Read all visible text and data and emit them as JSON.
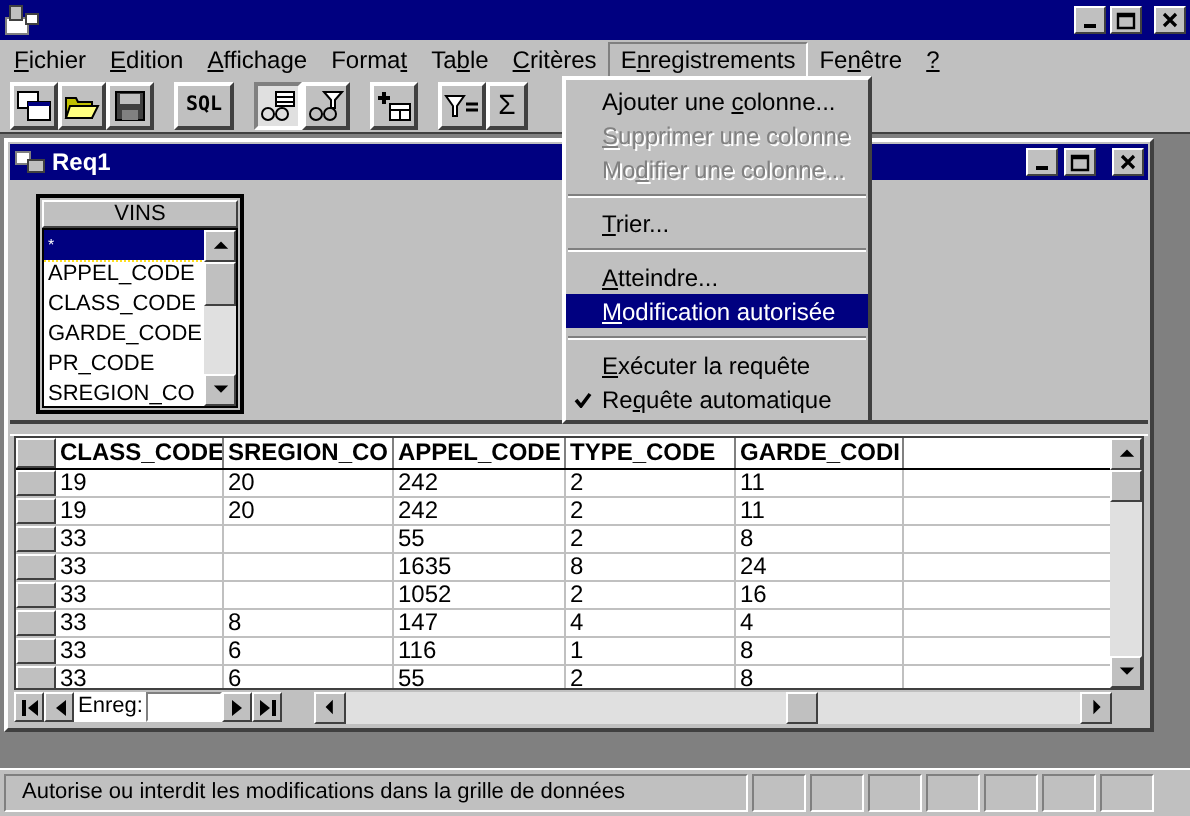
{
  "window": {
    "title": "Req1"
  },
  "menu": [
    {
      "label": "Fichier",
      "selected": false
    },
    {
      "label": "Edition",
      "selected": false
    },
    {
      "label": "Affichage",
      "selected": false
    },
    {
      "label": "Format",
      "selected": false
    },
    {
      "label": "Table",
      "selected": false
    },
    {
      "label": "Critères",
      "selected": false
    },
    {
      "label": "Enregistrements",
      "selected": true
    },
    {
      "label": "Fenêtre",
      "selected": false
    },
    {
      "label": "?",
      "selected": false
    }
  ],
  "toolbar": [
    [
      {
        "kind": "new",
        "pressed": false
      },
      {
        "kind": "open",
        "pressed": false
      },
      {
        "kind": "save",
        "pressed": false
      }
    ],
    [
      {
        "kind": "sql",
        "label": "SQL",
        "pressed": false
      }
    ],
    [
      {
        "kind": "design",
        "pressed": true
      },
      {
        "kind": "filter-view",
        "pressed": false
      }
    ],
    [
      {
        "kind": "add-table",
        "pressed": false
      }
    ],
    [
      {
        "kind": "filter",
        "pressed": false
      },
      {
        "kind": "sum",
        "label": "Σ",
        "pressed": false
      }
    ]
  ],
  "dropdown": [
    {
      "kind": "item",
      "label": "Ajouter une colonne...",
      "disabled": false,
      "selected": false,
      "checked": false
    },
    {
      "kind": "item",
      "label": "Supprimer une colonne",
      "disabled": true,
      "selected": false,
      "checked": false
    },
    {
      "kind": "item",
      "label": "Modifier une colonne...",
      "disabled": true,
      "selected": false,
      "checked": false
    },
    {
      "kind": "separator"
    },
    {
      "kind": "item",
      "label": "Trier...",
      "disabled": false,
      "selected": false,
      "checked": false
    },
    {
      "kind": "separator"
    },
    {
      "kind": "item",
      "label": "Atteindre...",
      "disabled": false,
      "selected": false,
      "checked": false
    },
    {
      "kind": "item",
      "label": "Modification autorisée",
      "disabled": false,
      "selected": true,
      "checked": false
    },
    {
      "kind": "separator"
    },
    {
      "kind": "item",
      "label": "Exécuter la requête",
      "disabled": false,
      "selected": false,
      "checked": false
    },
    {
      "kind": "item",
      "label": "Requête automatique",
      "disabled": false,
      "selected": false,
      "checked": true
    }
  ],
  "table_list": {
    "title": "VINS",
    "items": [
      {
        "label": "*",
        "selected": true
      },
      {
        "label": "APPEL_CODE",
        "selected": false
      },
      {
        "label": "CLASS_CODE",
        "selected": false
      },
      {
        "label": "GARDE_CODE",
        "selected": false
      },
      {
        "label": "PR_CODE",
        "selected": false
      },
      {
        "label": "SREGION_CO",
        "selected": false
      }
    ]
  },
  "grid": {
    "columns": [
      "CLASS_CODE",
      "SREGION_CO",
      "APPEL_CODE",
      "TYPE_CODE",
      "GARDE_CODI"
    ],
    "rows": [
      [
        "19",
        "20",
        "242",
        "2",
        "11"
      ],
      [
        "19",
        "20",
        "242",
        "2",
        "11"
      ],
      [
        "33",
        null,
        "55",
        "2",
        "8"
      ],
      [
        "33",
        null,
        "1635",
        "8",
        "24"
      ],
      [
        "33",
        null,
        "1052",
        "2",
        "16"
      ],
      [
        "33",
        "8",
        "147",
        "4",
        "4"
      ],
      [
        "33",
        "6",
        "116",
        "1",
        "8"
      ],
      [
        "33",
        "6",
        "55",
        "2",
        "8"
      ]
    ]
  },
  "navigator": {
    "label": "Enreg:"
  },
  "status_bar": {
    "text": "Autorise ou interdit les modifications dans la grille de données"
  }
}
